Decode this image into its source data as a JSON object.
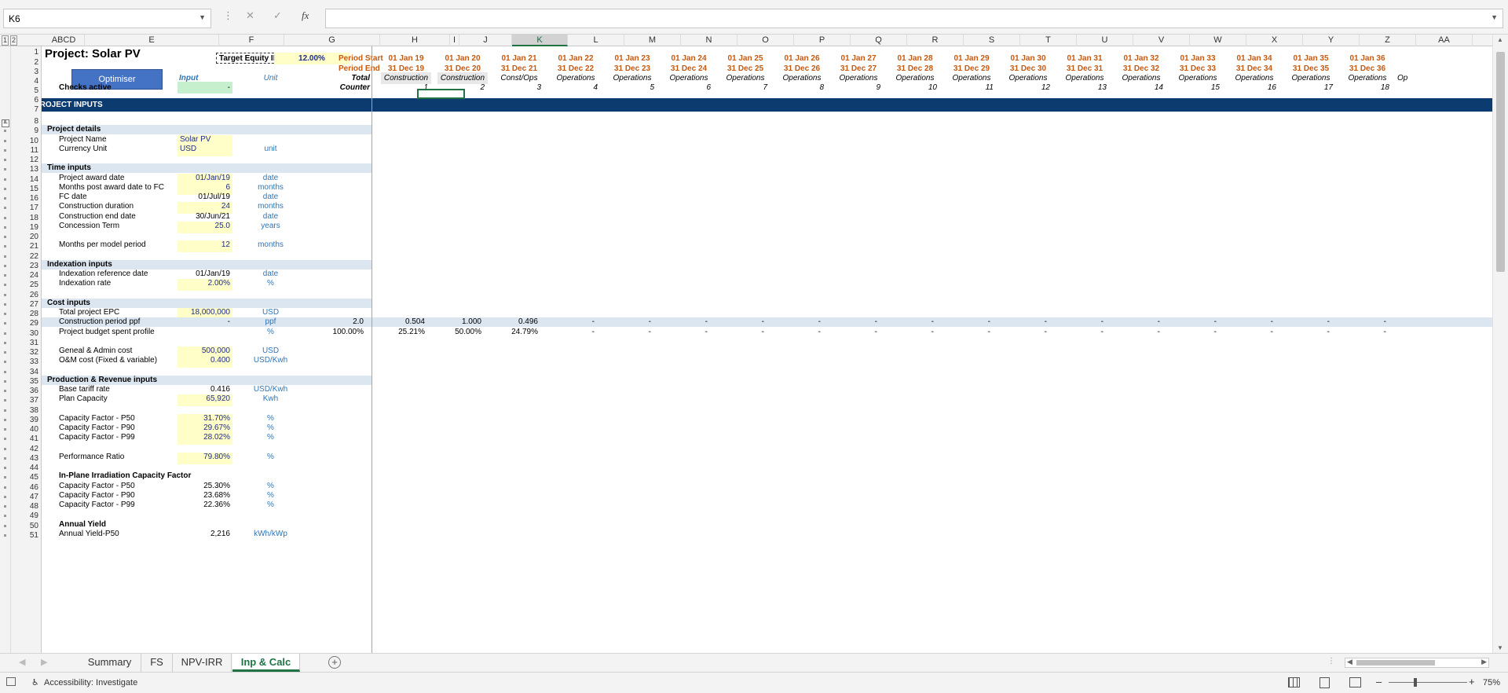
{
  "formula_bar": {
    "name_box": "K6",
    "formula": ""
  },
  "columns": [
    "ABCD",
    "E",
    "F",
    "G",
    "H",
    "I",
    "J",
    "K",
    "L",
    "M",
    "N",
    "O",
    "P",
    "Q",
    "R",
    "S",
    "T",
    "U",
    "V",
    "W",
    "X",
    "Y",
    "Z",
    "AA"
  ],
  "outline_levels": [
    "1",
    "2"
  ],
  "header_block": {
    "title": "Project: Solar PV",
    "optimiser_label": "Optimiser",
    "target_irr_label": "Target Equity IRR",
    "target_irr_value": "12.00%",
    "input_label": "Input",
    "unit_label": "Unit",
    "checks_label": "Checks active",
    "checks_value": "-",
    "period_start_label": "Period Start",
    "period_end_label": "Period End",
    "total_label": "Total",
    "counter_label": "Counter",
    "timeline": [
      {
        "start": "01 Jan 19",
        "end": "31 Dec 19",
        "phase": "Construction",
        "counter": "1"
      },
      {
        "start": "01 Jan 20",
        "end": "31 Dec 20",
        "phase": "Construction",
        "counter": "2"
      },
      {
        "start": "01 Jan 21",
        "end": "31 Dec 21",
        "phase": "Const/Ops",
        "counter": "3"
      },
      {
        "start": "01 Jan 22",
        "end": "31 Dec 22",
        "phase": "Operations",
        "counter": "4"
      },
      {
        "start": "01 Jan 23",
        "end": "31 Dec 23",
        "phase": "Operations",
        "counter": "5"
      },
      {
        "start": "01 Jan 24",
        "end": "31 Dec 24",
        "phase": "Operations",
        "counter": "6"
      },
      {
        "start": "01 Jan 25",
        "end": "31 Dec 25",
        "phase": "Operations",
        "counter": "7"
      },
      {
        "start": "01 Jan 26",
        "end": "31 Dec 26",
        "phase": "Operations",
        "counter": "8"
      },
      {
        "start": "01 Jan 27",
        "end": "31 Dec 27",
        "phase": "Operations",
        "counter": "9"
      },
      {
        "start": "01 Jan 28",
        "end": "31 Dec 28",
        "phase": "Operations",
        "counter": "10"
      },
      {
        "start": "01 Jan 29",
        "end": "31 Dec 29",
        "phase": "Operations",
        "counter": "11"
      },
      {
        "start": "01 Jan 30",
        "end": "31 Dec 30",
        "phase": "Operations",
        "counter": "12"
      },
      {
        "start": "01 Jan 31",
        "end": "31 Dec 31",
        "phase": "Operations",
        "counter": "13"
      },
      {
        "start": "01 Jan 32",
        "end": "31 Dec 32",
        "phase": "Operations",
        "counter": "14"
      },
      {
        "start": "01 Jan 33",
        "end": "31 Dec 33",
        "phase": "Operations",
        "counter": "15"
      },
      {
        "start": "01 Jan 34",
        "end": "31 Dec 34",
        "phase": "Operations",
        "counter": "16"
      },
      {
        "start": "01 Jan 35",
        "end": "31 Dec 35",
        "phase": "Operations",
        "counter": "17"
      },
      {
        "start": "01 Jan 36",
        "end": "31 Dec 36",
        "phase": "Operations",
        "counter": "18"
      }
    ],
    "overflow_phase": "Op"
  },
  "banner": "PROJECT INPUTS",
  "rows": [
    {
      "n": "8"
    },
    {
      "n": "9",
      "section": "Project details"
    },
    {
      "n": "10",
      "label": "Project Name",
      "value": "Solar PV",
      "input": true,
      "align": "left"
    },
    {
      "n": "11",
      "label": "Currency Unit",
      "value": "USD",
      "input": true,
      "align": "left",
      "unit": "unit"
    },
    {
      "n": "12"
    },
    {
      "n": "13",
      "section": "Time inputs"
    },
    {
      "n": "14",
      "label": "Project award date",
      "value": "01/Jan/19",
      "input": true,
      "unit": "date"
    },
    {
      "n": "15",
      "label": "Months post award date to FC",
      "value": "6",
      "input": true,
      "unit": "months"
    },
    {
      "n": "16",
      "label": "FC date",
      "value": "01/Jul/19",
      "unit": "date"
    },
    {
      "n": "17",
      "label": "Construction duration",
      "value": "24",
      "input": true,
      "unit": "months"
    },
    {
      "n": "18",
      "label": "Construction end date",
      "value": "30/Jun/21",
      "unit": "date"
    },
    {
      "n": "19",
      "label": "Concession Term",
      "value": "25.0",
      "input": true,
      "unit": "years"
    },
    {
      "n": "20"
    },
    {
      "n": "21",
      "label": "Months per model period",
      "value": "12",
      "input": true,
      "unit": "months"
    },
    {
      "n": "22"
    },
    {
      "n": "23",
      "section": "Indexation inputs"
    },
    {
      "n": "24",
      "label": "Indexation reference date",
      "value": "01/Jan/19",
      "unit": "date"
    },
    {
      "n": "25",
      "label": "Indexation rate",
      "value": "2.00%",
      "input": true,
      "unit": "%"
    },
    {
      "n": "26"
    },
    {
      "n": "27",
      "section": "Cost inputs"
    },
    {
      "n": "28",
      "label": "Total project EPC",
      "value": "18,000,000",
      "input": true,
      "unit": "USD"
    },
    {
      "n": "29",
      "label": "Construction period ppf",
      "value": "-",
      "unit": "ppf",
      "total": "2.0",
      "series": [
        "0.504",
        "1.000",
        "0.496",
        "-",
        "-",
        "-",
        "-",
        "-",
        "-",
        "-",
        "-",
        "-",
        "-",
        "-",
        "-",
        "-",
        "-",
        "-"
      ],
      "shade": true
    },
    {
      "n": "30",
      "label": "Project budget spent profile",
      "unit": "%",
      "total": "100.00%",
      "series": [
        "25.21%",
        "50.00%",
        "24.79%",
        "-",
        "-",
        "-",
        "-",
        "-",
        "-",
        "-",
        "-",
        "-",
        "-",
        "-",
        "-",
        "-",
        "-",
        "-"
      ]
    },
    {
      "n": "31"
    },
    {
      "n": "32",
      "label": "Geneal & Admin cost",
      "value": "500,000",
      "input": true,
      "unit": "USD"
    },
    {
      "n": "33",
      "label": "O&M cost (Fixed & variable)",
      "value": "0.400",
      "input": true,
      "unit": "USD/Kwh"
    },
    {
      "n": "34"
    },
    {
      "n": "35",
      "section": "Production & Revenue inputs"
    },
    {
      "n": "36",
      "label": "Base tariff rate",
      "value": "0.416",
      "unit": "USD/Kwh"
    },
    {
      "n": "37",
      "label": "Plan Capacity",
      "value": "65,920",
      "input": true,
      "unit": "Kwh"
    },
    {
      "n": "38"
    },
    {
      "n": "39",
      "label": "Capacity Factor - P50",
      "value": "31.70%",
      "input": true,
      "unit": "%"
    },
    {
      "n": "40",
      "label": "Capacity Factor - P90",
      "value": "29.67%",
      "input": true,
      "unit": "%"
    },
    {
      "n": "41",
      "label": "Capacity Factor - P99",
      "value": "28.02%",
      "input": true,
      "unit": "%"
    },
    {
      "n": "42"
    },
    {
      "n": "43",
      "label": "Performance Ratio",
      "value": "79.80%",
      "input": true,
      "unit": "%"
    },
    {
      "n": "44"
    },
    {
      "n": "45",
      "label": "In-Plane Irradiation Capacity Factor",
      "bold": true
    },
    {
      "n": "46",
      "label": "Capacity Factor - P50",
      "value": "25.30%",
      "unit": "%"
    },
    {
      "n": "47",
      "label": "Capacity Factor - P90",
      "value": "23.68%",
      "unit": "%"
    },
    {
      "n": "48",
      "label": "Capacity Factor - P99",
      "value": "22.36%",
      "unit": "%"
    },
    {
      "n": "49"
    },
    {
      "n": "50",
      "label": "Annual Yield",
      "bold": true
    },
    {
      "n": "51",
      "label": "Annual Yield-P50",
      "value": "2,216",
      "unit": "kWh/kWp"
    }
  ],
  "sheet_tabs": [
    "Summary",
    "FS",
    "NPV-IRR",
    "Inp & Calc"
  ],
  "active_tab": "Inp & Calc",
  "status_bar": {
    "accessibility": "Accessibility: Investigate",
    "zoom": "75%"
  }
}
